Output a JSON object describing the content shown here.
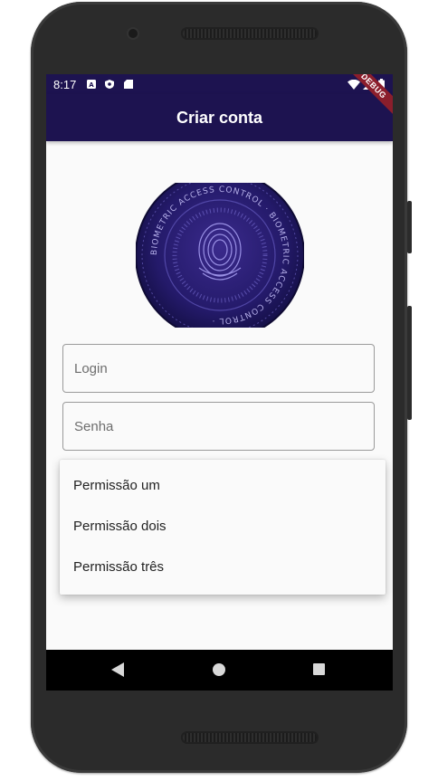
{
  "status_bar": {
    "time": "8:17"
  },
  "debug_banner": "DEBUG",
  "app_bar": {
    "title": "Criar conta"
  },
  "logo": {
    "ring_text": "BIOMETRIC ACCESS CONTROL · BIOMETRIC ACCESS CONTROL ·"
  },
  "form": {
    "login_placeholder": "Login",
    "password_placeholder": "Senha"
  },
  "permission_menu": {
    "options": [
      "Permissão um",
      "Permissão dois",
      "Permissão três"
    ]
  },
  "colors": {
    "primary": "#1d1350",
    "background": "#fafafa",
    "ribbon": "#8b1e2c"
  }
}
